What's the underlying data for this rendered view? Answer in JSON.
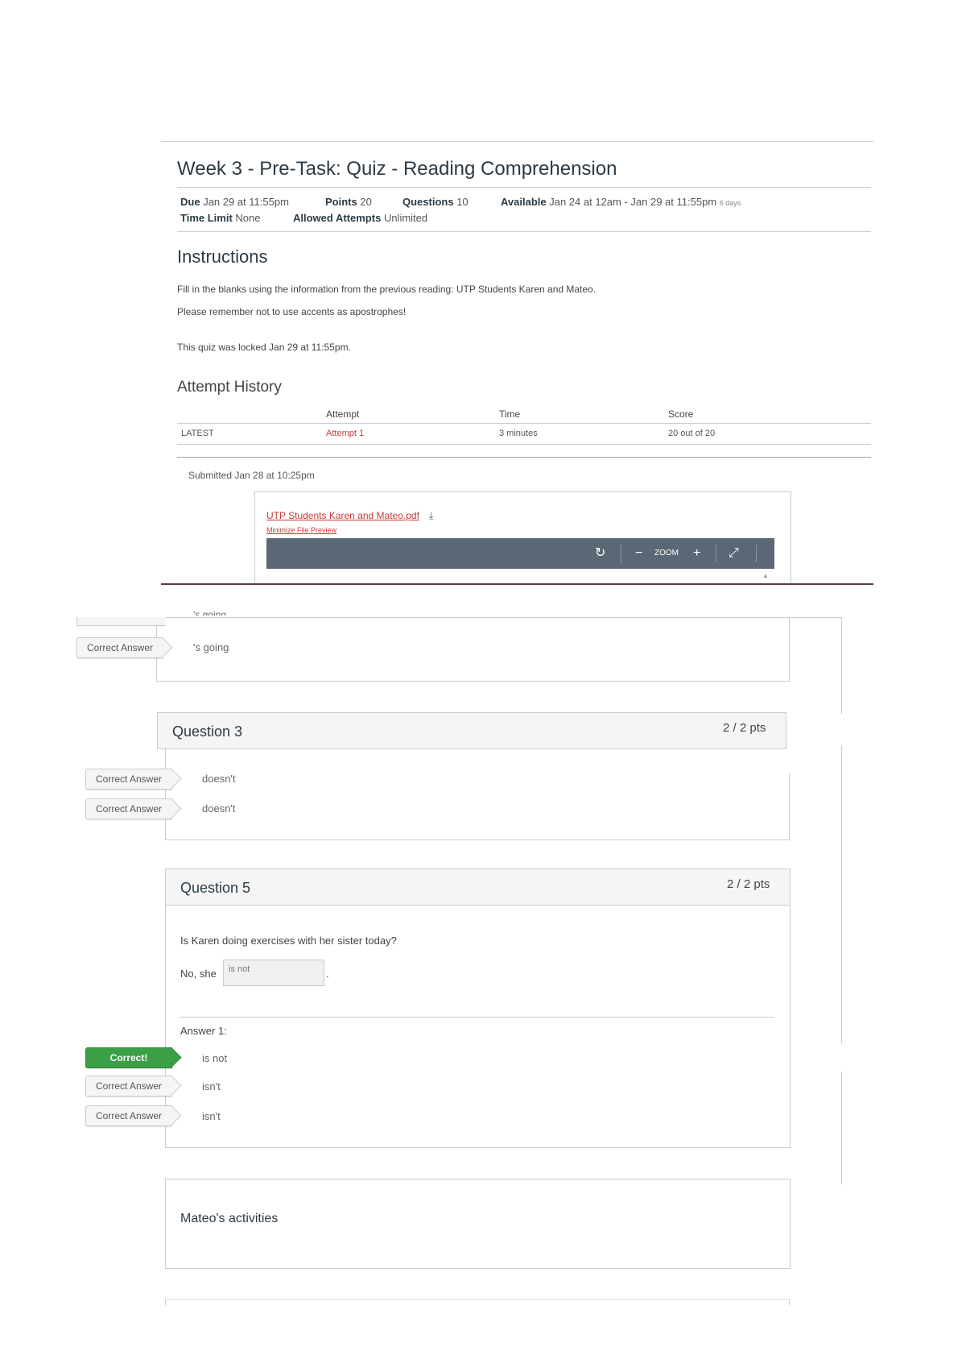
{
  "quiz": {
    "title": "Week 3 - Pre-Task: Quiz - Reading Comprehension",
    "due_label": "Due",
    "due_value": "Jan 29 at 11:55pm",
    "points_label": "Points",
    "points_value": "20",
    "questions_label": "Questions",
    "questions_value": "10",
    "available_label": "Available",
    "available_value": "Jan 24 at 12am - Jan 29 at 11:55pm",
    "available_days": "6 days",
    "time_limit_label": "Time Limit",
    "time_limit_value": "None",
    "attempts_label": "Allowed Attempts",
    "attempts_value": "Unlimited"
  },
  "instructions": {
    "heading": "Instructions",
    "line1": "Fill in the blanks using the information from the previous reading: UTP Students Karen and Mateo.",
    "line2": "Please remember not to use accents as apostrophes!",
    "locked": "This quiz was locked Jan 29 at 11:55pm."
  },
  "attempt_history": {
    "heading": "Attempt History",
    "columns": [
      "Attempt",
      "Time",
      "Score"
    ],
    "rows": [
      {
        "label": "LATEST",
        "attempt": "Attempt 1",
        "time": "3 minutes",
        "score": "20 out of 20"
      }
    ]
  },
  "submission": {
    "submitted": "Submitted Jan 28 at 10:25pm",
    "file_link": "UTP Students Karen and Mateo.pdf",
    "file_sub_link": "Minimize File Preview",
    "zoom_label": "ZOOM"
  },
  "question_fragment": {
    "tag": "Correct Answer",
    "answer": "'s going",
    "partial_answer": "'s going"
  },
  "question3": {
    "title": "Question 3",
    "points": "2 / 2 pts",
    "answers": [
      {
        "tag": "Correct Answer",
        "text": "doesn't"
      },
      {
        "tag": "Correct Answer",
        "text": "doesn't"
      }
    ]
  },
  "question5": {
    "title": "Question 5",
    "points": "2 / 2 pts",
    "prompt": "Is Karen doing exercises with her sister today?",
    "sentence_start": "No, she",
    "input_value": "is not",
    "sentence_end": ".",
    "answer_heading": "Answer 1:",
    "answers": [
      {
        "tag": "Correct!",
        "text": "is not"
      },
      {
        "tag": "Correct Answer",
        "text": "isn't"
      },
      {
        "tag": "Correct Answer",
        "text": "isn't"
      }
    ]
  },
  "section": {
    "title": "Mateo's activities"
  },
  "colors": {
    "correct_green": "#3b9f46",
    "link_red": "#c63a3a",
    "toolbar_bg": "#5a6875",
    "divider_dark": "#5a3a4a"
  }
}
